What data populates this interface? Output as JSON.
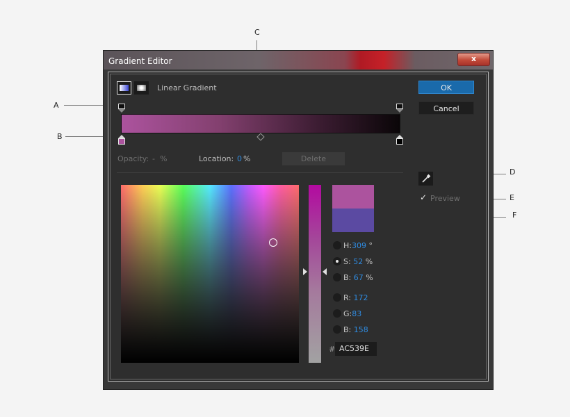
{
  "window": {
    "title": "Gradient Editor",
    "close_glyph": "x"
  },
  "gradient": {
    "type_label": "Linear Gradient",
    "types": [
      "linear-gradient-icon",
      "radial-gradient-icon"
    ],
    "stops": {
      "start": "#ac539e",
      "end": "#000000"
    }
  },
  "buttons": {
    "ok": "OK",
    "cancel": "Cancel",
    "delete": "Delete"
  },
  "stop_fields": {
    "opacity_label": "Opacity:",
    "opacity_value": "-",
    "opacity_unit": "%",
    "location_label": "Location:",
    "location_value": "0",
    "location_unit": "%"
  },
  "preview": {
    "check": "✓",
    "label": "Preview"
  },
  "color": {
    "new_swatch": "#ac539e",
    "old_swatch": "#5b4aa2",
    "fields": [
      {
        "label": "H:",
        "value": "309",
        "unit": "°",
        "selected": false
      },
      {
        "label": "S:",
        "value": "52",
        "unit": "%",
        "selected": true
      },
      {
        "label": "B:",
        "value": "67",
        "unit": "%",
        "selected": false
      },
      {
        "label": "R:",
        "value": "172",
        "unit": "",
        "selected": false
      },
      {
        "label": "G:",
        "value": "83",
        "unit": "",
        "selected": false
      },
      {
        "label": "B:",
        "value": "158",
        "unit": "",
        "selected": false
      }
    ],
    "hex_prefix": "#",
    "hex_value": "AC539E"
  },
  "annotations": [
    "A",
    "B",
    "C",
    "D",
    "E",
    "F"
  ]
}
